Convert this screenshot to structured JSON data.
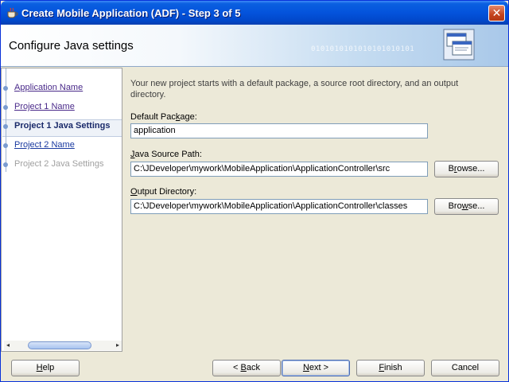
{
  "window": {
    "title": "Create Mobile Application (ADF) - Step 3 of 5",
    "close_glyph": "✕"
  },
  "banner": {
    "title": "Configure Java settings",
    "binary": "0101010101010101010101",
    "icon": "wizard-dialog-icon"
  },
  "steps": [
    {
      "label": "Application Name",
      "state": "visited"
    },
    {
      "label": "Project 1 Name",
      "state": "visited"
    },
    {
      "label": "Project 1 Java Settings",
      "state": "current"
    },
    {
      "label": "Project 2 Name",
      "state": "link"
    },
    {
      "label": "Project 2 Java Settings",
      "state": "disabled"
    }
  ],
  "form": {
    "description": "Your new project starts with a default package, a source root directory, and an output directory.",
    "default_package_label": "Default Package:",
    "default_package_value": "application",
    "java_source_label": "Java Source Path:",
    "java_source_value": "C:\\JDeveloper\\mywork\\MobileApplication\\ApplicationController\\src",
    "output_dir_label": "Output Directory:",
    "output_dir_value": "C:\\JDeveloper\\mywork\\MobileApplication\\ApplicationController\\classes",
    "browse_label": "Browse..."
  },
  "footer": {
    "help": "Help",
    "back": "< Back",
    "next": "Next >",
    "finish": "Finish",
    "cancel": "Cancel"
  },
  "colors": {
    "titlebar": "#0453dc",
    "current_step": "#1a2a6a",
    "visited_step": "#4a2a8a"
  }
}
